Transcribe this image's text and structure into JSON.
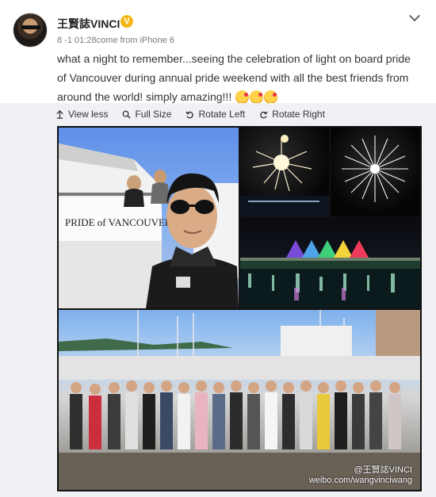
{
  "post": {
    "author": "王賢誌VINCI",
    "verified_badge": "V",
    "meta": "8 -1 01:28come from iPhone 6",
    "text": "what a night to remember...seeing the celebration of light on board pride of Vancouver during annual pride weekend with all the best friends from around the world! simply amazing!!!",
    "emojis": [
      "kiss-face",
      "kiss-face",
      "kiss-face"
    ]
  },
  "toolbar": {
    "view_less": "View less",
    "full_size": "Full Size",
    "rotate_left": "Rotate Left",
    "rotate_right": "Rotate Right"
  },
  "photo": {
    "sign_text": "PRIDE of VANCOUVER",
    "watermark_handle": "@王賢誌VINCI",
    "watermark_url": "weibo.com/wangvinciwang"
  },
  "colors": {
    "verified": "#f4b71a",
    "panel_bg": "#f0f1f5"
  }
}
